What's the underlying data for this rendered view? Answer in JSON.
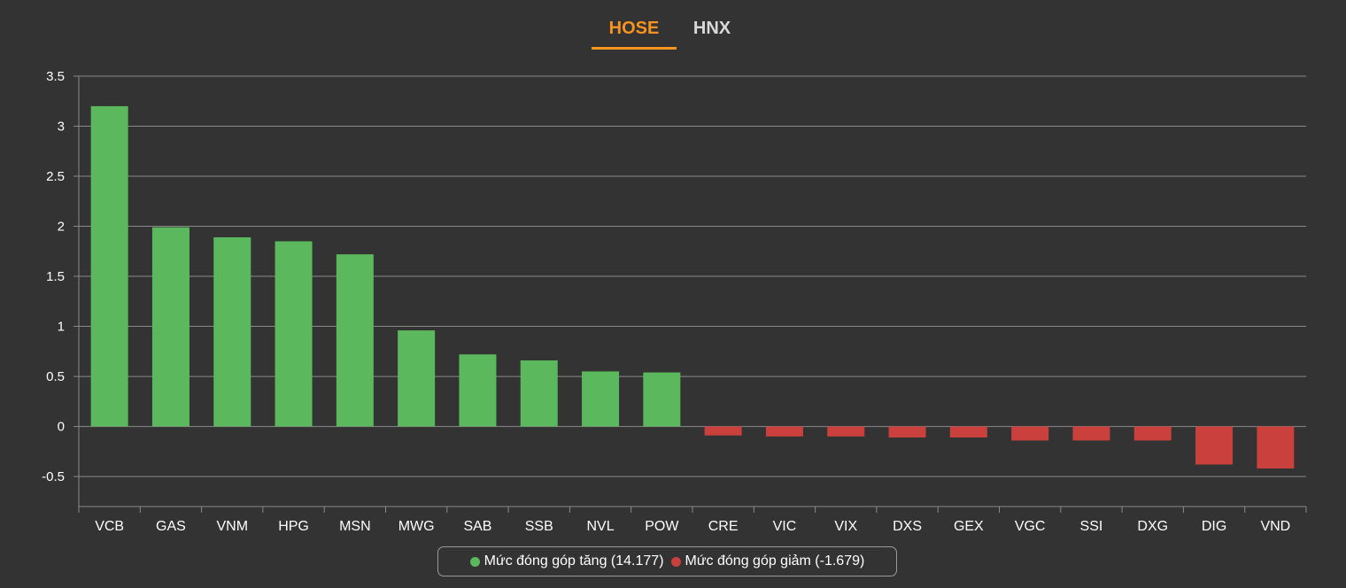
{
  "tabs": [
    {
      "label": "HOSE",
      "active": true
    },
    {
      "label": "HNX",
      "active": false
    }
  ],
  "colors": {
    "background": "#333333",
    "active_tab": "#f7931e",
    "positive": "#5cb85c",
    "negative": "#c9403d",
    "grid": "#8a8a8a",
    "text": "#ffffff"
  },
  "legend": [
    {
      "label": "Mức đóng góp tăng (14.177)",
      "color": "#5cb85c"
    },
    {
      "label": "Mức đóng góp giảm (-1.679)",
      "color": "#c9403d"
    }
  ],
  "chart_data": {
    "type": "bar",
    "categories": [
      "VCB",
      "GAS",
      "VNM",
      "HPG",
      "MSN",
      "MWG",
      "SAB",
      "SSB",
      "NVL",
      "POW",
      "CRE",
      "VIC",
      "VIX",
      "DXS",
      "GEX",
      "VGC",
      "SSI",
      "DXG",
      "DIG",
      "VND"
    ],
    "values": [
      3.2,
      1.99,
      1.89,
      1.85,
      1.72,
      0.96,
      0.72,
      0.66,
      0.55,
      0.54,
      -0.09,
      -0.1,
      -0.1,
      -0.11,
      -0.11,
      -0.14,
      -0.14,
      -0.14,
      -0.38,
      -0.42
    ],
    "ylim": [
      -0.8,
      3.5
    ],
    "yticks": [
      3.5,
      3,
      2.5,
      2,
      1.5,
      1,
      0.5,
      0,
      -0.5
    ],
    "ytick_labels": [
      "3.5",
      "3",
      "2.5",
      "2",
      "1.5",
      "1",
      "0.5",
      "0",
      "-0.5"
    ],
    "grid": true,
    "legend_position": "bottom"
  }
}
